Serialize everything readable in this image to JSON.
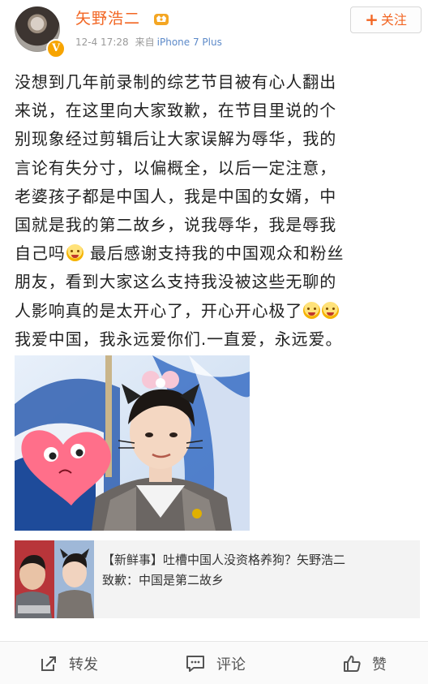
{
  "header": {
    "username": "矢野浩二",
    "timestamp": "12-4 17:28",
    "source_prefix": "来自",
    "source": "iPhone 7 Plus",
    "follow_label": "关注",
    "verified_badge": "V"
  },
  "post": {
    "lines": [
      "没想到几年前录制的综艺节目被有心人翻出",
      "来说，在这里向大家致歉，在节目里说的个",
      "别现象经过剪辑后让大家误解为辱华，我的",
      "言论有失分寸，以偏概全，以后一定注意，",
      "老婆孩子都是中国人，我是中国的女婿，中",
      "国就是我的第二故乡，说我辱华，我是辱我"
    ],
    "line7_a": "自己吗",
    "line7_b": " 最后感谢支持我的中国观众和粉丝",
    "line8": "朋友，看到大家这么支持我没被这些无聊的",
    "line9": "人影响真的是太开心了，开心开心极了",
    "line10": "我爱中国，我永远爱你们.一直爱，永远爱。",
    "emoji_names": [
      "crying-laugh-emoji",
      "scream-emoji",
      "scream-emoji"
    ]
  },
  "link_card": {
    "title": "【新鲜事】吐槽中国人没资格养狗？矢野浩二\n致歉：中国是第二故乡"
  },
  "toolbar": {
    "repost_label": "转发",
    "comment_label": "评论",
    "like_label": "赞"
  },
  "colors": {
    "accent": "#f26522",
    "link": "#5d8ac9",
    "meta": "#9a9a9a"
  }
}
